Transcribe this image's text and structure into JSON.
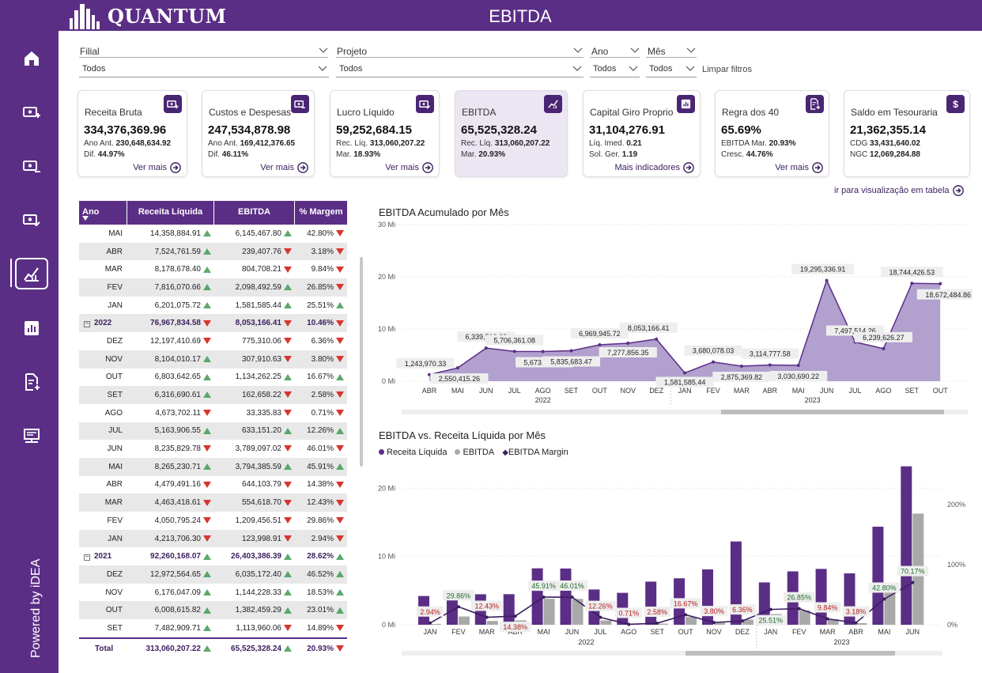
{
  "app": {
    "logo": "QUANTUM",
    "title": "EBITDA",
    "powered_by": "Powered by iDEA"
  },
  "filters": {
    "filial": {
      "label": "Filial",
      "value": "Todos"
    },
    "projeto": {
      "label": "Projeto",
      "value": "Todos"
    },
    "ano": {
      "label": "Ano",
      "value": "Todos"
    },
    "mes": {
      "label": "Mês",
      "value": "Todos"
    },
    "clear": "Limpar filtros"
  },
  "cards": [
    {
      "title": "Receita Bruta",
      "value": "334,376,369.96",
      "l1_label": "Ano Ant.",
      "l1_value": "230,648,634.92",
      "l2_label": "Dif.",
      "l2_value": "44.97%",
      "l2_status": "green",
      "link": "Ver mais",
      "icon": "money-plus-icon"
    },
    {
      "title": "Custos e Despesas",
      "value": "247,534,878.98",
      "l1_label": "Ano Ant.",
      "l1_value": "169,412,376.65",
      "l2_label": "Dif.",
      "l2_value": "46.11%",
      "l2_status": "red",
      "link": "Ver mais",
      "icon": "money-minus-icon"
    },
    {
      "title": "Lucro Líquido",
      "value": "59,252,684.15",
      "l1_label": "Rec. Líq.",
      "l1_value": "313,060,207.22",
      "l2_label": "Mar.",
      "l2_value": "18.93%",
      "l2_status": "green",
      "link": "Ver mais",
      "icon": "money-check-icon"
    },
    {
      "title": "EBITDA",
      "value": "65,525,328.24",
      "l1_label": "Rec. Líq.",
      "l1_value": "313,060,207.22",
      "l2_label": "Mar.",
      "l2_value": "20.93%",
      "l2_status": "green",
      "link": "",
      "icon": "chart-trend-icon"
    },
    {
      "title": "Capital Giro Proprio",
      "value": "31,104,276.91",
      "l1_label": "Líq. Imed.",
      "l1_value": "0.21",
      "l2_label": "Sol. Ger.",
      "l2_value": "1.19",
      "l2_status": "green",
      "link": "Mais indicadores",
      "icon": "bar-chart-icon"
    },
    {
      "title": "Regra dos 40",
      "value": "65.69%",
      "l1_label": "EBITDA Mar.",
      "l1_value": "20.93%",
      "l2_label": "Cresc.",
      "l2_value": "44.76%",
      "l2_status": "green",
      "link": "Ver mais",
      "icon": "document-plus-icon"
    },
    {
      "title": "Saldo em Tesouraria",
      "value": "21,362,355.14",
      "l1_label": "CDG",
      "l1_value": "33,431,640.02",
      "l2_label": "NGC",
      "l2_value": "12,069,284.88",
      "l2_status": "plain",
      "link": "",
      "icon": "dollar-icon"
    }
  ],
  "table_view_link": "ir para visualização em tabela",
  "table": {
    "headers": [
      "Ano",
      "Receita Líquida",
      "EBITDA",
      "% Margem"
    ],
    "rows": [
      {
        "t": "m",
        "label": "MAI",
        "rl": "14,358,884.91",
        "rl_d": "up",
        "eb": "6,145,467.80",
        "eb_d": "up",
        "mg": "42.80%",
        "mg_d": "down"
      },
      {
        "t": "m",
        "label": "ABR",
        "rl": "7,524,761.59",
        "rl_d": "up",
        "eb": "239,407.76",
        "eb_d": "down",
        "mg": "3.18%",
        "mg_d": "down"
      },
      {
        "t": "m",
        "label": "MAR",
        "rl": "8,178,678.40",
        "rl_d": "up",
        "eb": "804,708.21",
        "eb_d": "down",
        "mg": "9.84%",
        "mg_d": "down"
      },
      {
        "t": "m",
        "label": "FEV",
        "rl": "7,816,070.66",
        "rl_d": "up",
        "eb": "2,098,492.59",
        "eb_d": "up",
        "mg": "26.85%",
        "mg_d": "down"
      },
      {
        "t": "m",
        "label": "JAN",
        "rl": "6,201,075.72",
        "rl_d": "up",
        "eb": "1,581,585.44",
        "eb_d": "up",
        "mg": "25.51%",
        "mg_d": "up"
      },
      {
        "t": "y",
        "label": "2022",
        "rl": "76,967,834.58",
        "rl_d": "down",
        "eb": "8,053,166.41",
        "eb_d": "down",
        "mg": "10.46%",
        "mg_d": "down"
      },
      {
        "t": "m",
        "label": "DEZ",
        "rl": "12,197,410.69",
        "rl_d": "down",
        "eb": "775,310.06",
        "eb_d": "down",
        "mg": "6.36%",
        "mg_d": "down"
      },
      {
        "t": "m",
        "label": "NOV",
        "rl": "8,104,010.17",
        "rl_d": "up",
        "eb": "307,910.63",
        "eb_d": "down",
        "mg": "3.80%",
        "mg_d": "down"
      },
      {
        "t": "m",
        "label": "OUT",
        "rl": "6,803,642.65",
        "rl_d": "up",
        "eb": "1,134,262.25",
        "eb_d": "up",
        "mg": "16.67%",
        "mg_d": "up"
      },
      {
        "t": "m",
        "label": "SET",
        "rl": "6,316,690.61",
        "rl_d": "up",
        "eb": "162,658.22",
        "eb_d": "down",
        "mg": "2.58%",
        "mg_d": "down"
      },
      {
        "t": "m",
        "label": "AGO",
        "rl": "4,673,702.11",
        "rl_d": "down",
        "eb": "33,335.83",
        "eb_d": "down",
        "mg": "0.71%",
        "mg_d": "down"
      },
      {
        "t": "m",
        "label": "JUL",
        "rl": "5,163,906.55",
        "rl_d": "up",
        "eb": "633,151.20",
        "eb_d": "up",
        "mg": "12.26%",
        "mg_d": "up"
      },
      {
        "t": "m",
        "label": "JUN",
        "rl": "8,235,829.78",
        "rl_d": "down",
        "eb": "3,789,097.02",
        "eb_d": "down",
        "mg": "46.01%",
        "mg_d": "down"
      },
      {
        "t": "m",
        "label": "MAI",
        "rl": "8,265,230.71",
        "rl_d": "up",
        "eb": "3,794,385.59",
        "eb_d": "up",
        "mg": "45.91%",
        "mg_d": "up"
      },
      {
        "t": "m",
        "label": "ABR",
        "rl": "4,479,491.16",
        "rl_d": "down",
        "eb": "644,103.79",
        "eb_d": "down",
        "mg": "14.38%",
        "mg_d": "down"
      },
      {
        "t": "m",
        "label": "MAR",
        "rl": "4,463,418.61",
        "rl_d": "down",
        "eb": "554,618.70",
        "eb_d": "down",
        "mg": "12.43%",
        "mg_d": "down"
      },
      {
        "t": "m",
        "label": "FEV",
        "rl": "4,050,795.24",
        "rl_d": "down",
        "eb": "1,209,456.51",
        "eb_d": "down",
        "mg": "29.86%",
        "mg_d": "down"
      },
      {
        "t": "m",
        "label": "JAN",
        "rl": "4,213,706.30",
        "rl_d": "down",
        "eb": "123,998.91",
        "eb_d": "down",
        "mg": "2.94%",
        "mg_d": "down"
      },
      {
        "t": "y",
        "label": "2021",
        "rl": "92,260,168.07",
        "rl_d": "up",
        "eb": "26,403,386.39",
        "eb_d": "up",
        "mg": "28.62%",
        "mg_d": "up"
      },
      {
        "t": "m",
        "label": "DEZ",
        "rl": "12,972,564.65",
        "rl_d": "up",
        "eb": "6,035,172.40",
        "eb_d": "up",
        "mg": "46.52%",
        "mg_d": "up"
      },
      {
        "t": "m",
        "label": "NOV",
        "rl": "6,176,047.09",
        "rl_d": "up",
        "eb": "1,144,228.33",
        "eb_d": "up",
        "mg": "18.53%",
        "mg_d": "up"
      },
      {
        "t": "m",
        "label": "OUT",
        "rl": "6,008,615.82",
        "rl_d": "up",
        "eb": "1,382,459.29",
        "eb_d": "up",
        "mg": "23.01%",
        "mg_d": "up"
      },
      {
        "t": "m",
        "label": "SET",
        "rl": "7,482,909.71",
        "rl_d": "up",
        "eb": "1,113,960.06",
        "eb_d": "down",
        "mg": "14.89%",
        "mg_d": "down"
      }
    ],
    "total": {
      "label": "Total",
      "rl": "313,060,207.22",
      "rl_d": "up",
      "eb": "65,525,328.24",
      "eb_d": "up",
      "mg": "20.93%",
      "mg_d": "down"
    }
  },
  "chart_data": [
    {
      "type": "area",
      "title": "EBITDA Acumulado por Mês",
      "y_ticks": [
        "0 Mi",
        "10 Mi",
        "20 Mi",
        "30 Mi"
      ],
      "ylim": [
        0,
        30000000
      ],
      "categories": [
        "ABR",
        "MAI",
        "JUN",
        "JUL",
        "AGO",
        "SET",
        "OUT",
        "NOV",
        "DEZ",
        "JAN",
        "FEV",
        "MAR",
        "ABR",
        "MAI",
        "JUN",
        "JUL",
        "AGO",
        "SET",
        "OUT"
      ],
      "groups": [
        {
          "label": "2022",
          "from": 0,
          "to": 8
        },
        {
          "label": "2023",
          "from": 9,
          "to": 18
        }
      ],
      "values": [
        1243970.33,
        2550415.26,
        6339512.28,
        5706361.08,
        5673025.25,
        5835683.47,
        6969945.72,
        7277856.35,
        8053166.41,
        1581585.44,
        3680078.03,
        2875369.82,
        3114777.58,
        3030690.22,
        19295336.91,
        7497514.26,
        6239626.27,
        18744426.53,
        18672484.86
      ],
      "labels": [
        "1,243,970.33",
        "2,550,415.26",
        "6,339,512.28",
        "5,706,361.08",
        "5,673,025.25",
        "5,835,683.47",
        "6,969,945.72",
        "7,277,856.35",
        "8,053,166.41",
        "1,581,585.44",
        "3,680,078.03",
        "2,875,369.82",
        "3,114,777.58",
        "3,030,690.22",
        "19,295,336.91",
        "7,497,514.26",
        "6,239,626.27",
        "18,744,426.53",
        "18,672,484.86"
      ]
    },
    {
      "type": "bar",
      "title": "EBITDA vs. Receita Líquida por Mês",
      "legend": [
        "Receita Líquida",
        "EBITDA",
        "EBITDA Margin"
      ],
      "colors": {
        "receita": "#5b2e86",
        "ebitda": "#a9a9a9",
        "margin": "#3b1f5e"
      },
      "y_ticks": [
        "0 Mi",
        "10 Mi",
        "20 Mi"
      ],
      "y2_ticks": [
        "0%",
        "100%",
        "200%"
      ],
      "ylim": [
        0,
        22000000
      ],
      "categories": [
        "JAN",
        "FEV",
        "MAR",
        "ABR",
        "MAI",
        "JUN",
        "JUL",
        "AGO",
        "SET",
        "OUT",
        "NOV",
        "DEZ",
        "JAN",
        "FEV",
        "MAR",
        "ABR",
        "MAI",
        "JUN"
      ],
      "groups": [
        {
          "label": "2022",
          "from": 0,
          "to": 11
        },
        {
          "label": "2023",
          "from": 12,
          "to": 17
        }
      ],
      "series": [
        {
          "name": "Receita Líquida",
          "values": [
            4213706.3,
            4050795.24,
            4463418.61,
            4479491.16,
            8265230.71,
            8235829.78,
            5163906.55,
            4673702.11,
            6316690.61,
            6803642.65,
            8104010.17,
            12197410.69,
            6201075.72,
            7816070.66,
            8178678.4,
            7524761.59,
            14358884.91,
            23200000
          ]
        },
        {
          "name": "EBITDA",
          "values": [
            123998.91,
            1209456.51,
            554618.7,
            644103.79,
            3794385.59,
            3789097.02,
            633151.2,
            33335.83,
            162658.22,
            1134262.25,
            307910.63,
            775310.06,
            1581585.44,
            2098492.59,
            804708.21,
            239407.76,
            6145467.8,
            16280000
          ]
        },
        {
          "name": "EBITDA Margin",
          "values": [
            2.94,
            29.86,
            12.43,
            14.38,
            45.91,
            46.01,
            12.26,
            0.71,
            2.58,
            16.67,
            3.8,
            6.36,
            25.51,
            26.85,
            9.84,
            3.18,
            42.8,
            70.17
          ]
        }
      ],
      "margin_labels": [
        "2.94%",
        "29.86%",
        "12.43%",
        "14.38%",
        "45.91%",
        "46.01%",
        "12.26%",
        "0.71%",
        "2.58%",
        "16.67%",
        "3.80%",
        "6.36%",
        "25.51%",
        "26.85%",
        "9.84%",
        "3.18%",
        "42.80%",
        "70.17%"
      ]
    }
  ]
}
